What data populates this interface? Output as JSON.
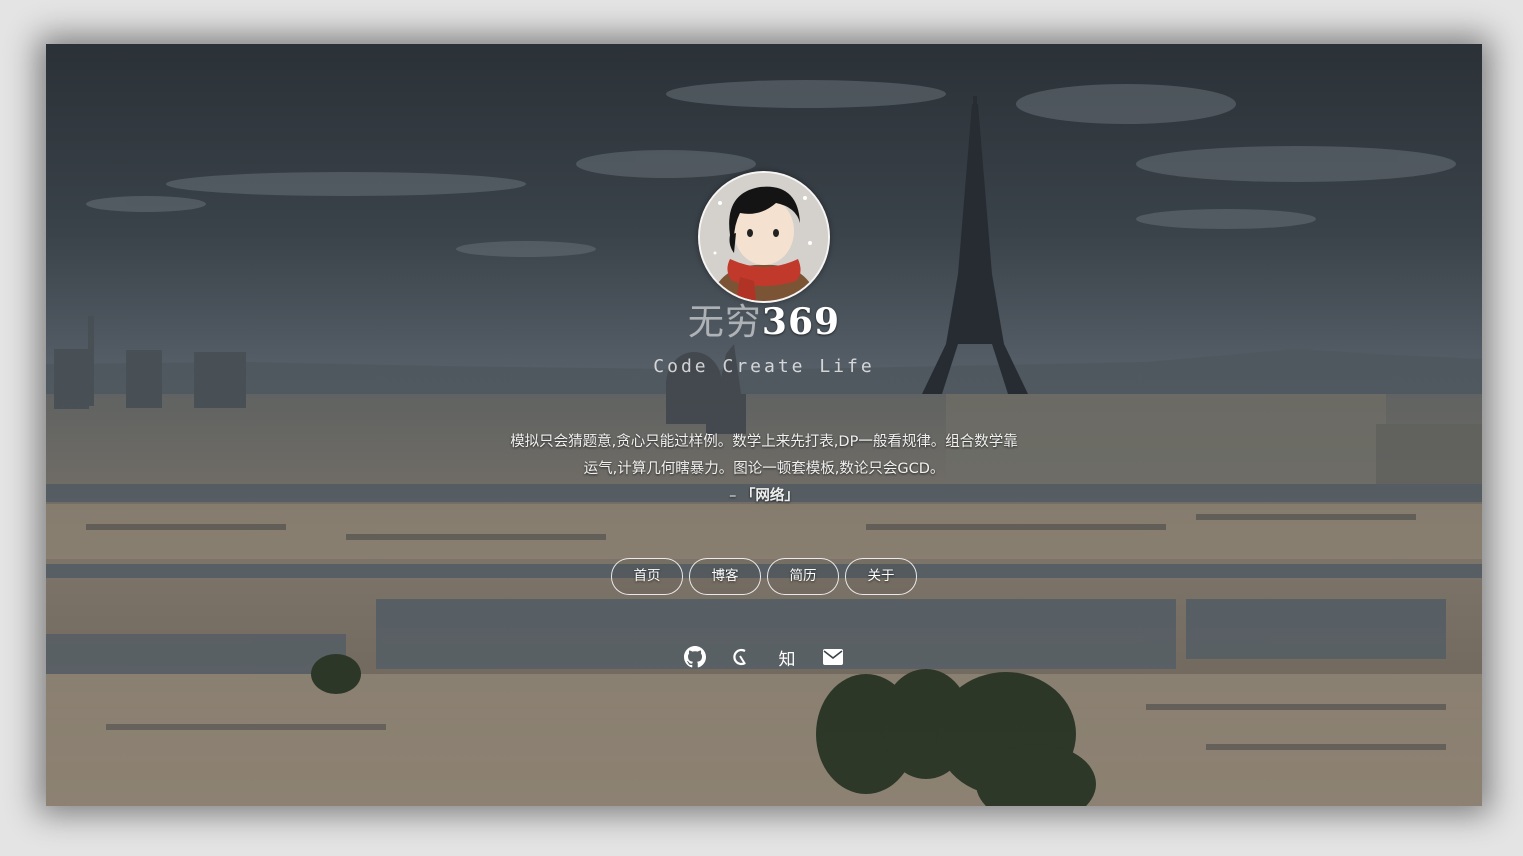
{
  "profile": {
    "name_cn": "无穷",
    "name_num": "369",
    "tagline": "Code Create Life"
  },
  "quote": {
    "line1": "模拟只会猜题意,贪心只能过样例。数学上来先打表,DP一般看规律。组合数学靠",
    "line2": "运气,计算几何瞎暴力。图论一顿套模板,数论只会GCD。",
    "source_prefix": "– ",
    "source": "「网络」"
  },
  "nav": {
    "items": [
      {
        "label": "首页"
      },
      {
        "label": "博客"
      },
      {
        "label": "简历"
      },
      {
        "label": "关于"
      }
    ]
  },
  "social": {
    "icons": [
      "github-icon",
      "csdn-icon",
      "zhihu-icon",
      "mail-icon"
    ],
    "zhihu_label": "知"
  },
  "colors": {
    "sky": "#4a5560",
    "buildings": "#8c8274",
    "roofs": "#5f6a73",
    "scarf": "#c0392b"
  }
}
